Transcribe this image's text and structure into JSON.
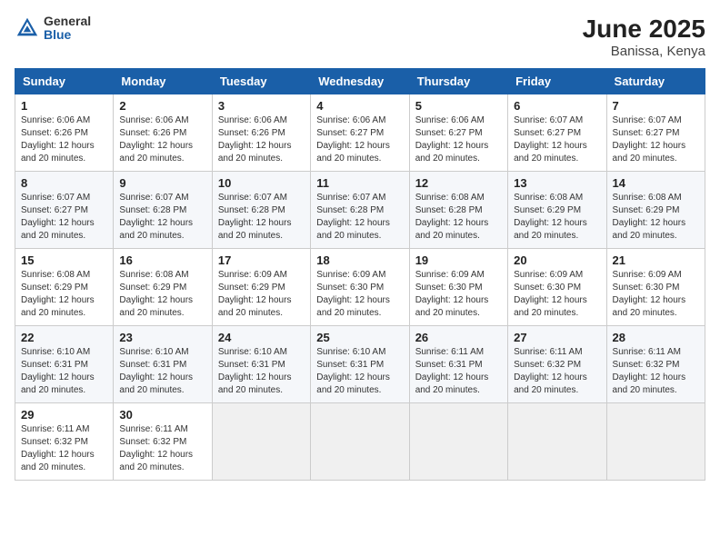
{
  "header": {
    "logo_general": "General",
    "logo_blue": "Blue",
    "month": "June 2025",
    "location": "Banissa, Kenya"
  },
  "weekdays": [
    "Sunday",
    "Monday",
    "Tuesday",
    "Wednesday",
    "Thursday",
    "Friday",
    "Saturday"
  ],
  "weeks": [
    [
      {
        "day": "1",
        "sunrise": "6:06 AM",
        "sunset": "6:26 PM",
        "daylight": "12 hours and 20 minutes."
      },
      {
        "day": "2",
        "sunrise": "6:06 AM",
        "sunset": "6:26 PM",
        "daylight": "12 hours and 20 minutes."
      },
      {
        "day": "3",
        "sunrise": "6:06 AM",
        "sunset": "6:26 PM",
        "daylight": "12 hours and 20 minutes."
      },
      {
        "day": "4",
        "sunrise": "6:06 AM",
        "sunset": "6:27 PM",
        "daylight": "12 hours and 20 minutes."
      },
      {
        "day": "5",
        "sunrise": "6:06 AM",
        "sunset": "6:27 PM",
        "daylight": "12 hours and 20 minutes."
      },
      {
        "day": "6",
        "sunrise": "6:07 AM",
        "sunset": "6:27 PM",
        "daylight": "12 hours and 20 minutes."
      },
      {
        "day": "7",
        "sunrise": "6:07 AM",
        "sunset": "6:27 PM",
        "daylight": "12 hours and 20 minutes."
      }
    ],
    [
      {
        "day": "8",
        "sunrise": "6:07 AM",
        "sunset": "6:27 PM",
        "daylight": "12 hours and 20 minutes."
      },
      {
        "day": "9",
        "sunrise": "6:07 AM",
        "sunset": "6:28 PM",
        "daylight": "12 hours and 20 minutes."
      },
      {
        "day": "10",
        "sunrise": "6:07 AM",
        "sunset": "6:28 PM",
        "daylight": "12 hours and 20 minutes."
      },
      {
        "day": "11",
        "sunrise": "6:07 AM",
        "sunset": "6:28 PM",
        "daylight": "12 hours and 20 minutes."
      },
      {
        "day": "12",
        "sunrise": "6:08 AM",
        "sunset": "6:28 PM",
        "daylight": "12 hours and 20 minutes."
      },
      {
        "day": "13",
        "sunrise": "6:08 AM",
        "sunset": "6:29 PM",
        "daylight": "12 hours and 20 minutes."
      },
      {
        "day": "14",
        "sunrise": "6:08 AM",
        "sunset": "6:29 PM",
        "daylight": "12 hours and 20 minutes."
      }
    ],
    [
      {
        "day": "15",
        "sunrise": "6:08 AM",
        "sunset": "6:29 PM",
        "daylight": "12 hours and 20 minutes."
      },
      {
        "day": "16",
        "sunrise": "6:08 AM",
        "sunset": "6:29 PM",
        "daylight": "12 hours and 20 minutes."
      },
      {
        "day": "17",
        "sunrise": "6:09 AM",
        "sunset": "6:29 PM",
        "daylight": "12 hours and 20 minutes."
      },
      {
        "day": "18",
        "sunrise": "6:09 AM",
        "sunset": "6:30 PM",
        "daylight": "12 hours and 20 minutes."
      },
      {
        "day": "19",
        "sunrise": "6:09 AM",
        "sunset": "6:30 PM",
        "daylight": "12 hours and 20 minutes."
      },
      {
        "day": "20",
        "sunrise": "6:09 AM",
        "sunset": "6:30 PM",
        "daylight": "12 hours and 20 minutes."
      },
      {
        "day": "21",
        "sunrise": "6:09 AM",
        "sunset": "6:30 PM",
        "daylight": "12 hours and 20 minutes."
      }
    ],
    [
      {
        "day": "22",
        "sunrise": "6:10 AM",
        "sunset": "6:31 PM",
        "daylight": "12 hours and 20 minutes."
      },
      {
        "day": "23",
        "sunrise": "6:10 AM",
        "sunset": "6:31 PM",
        "daylight": "12 hours and 20 minutes."
      },
      {
        "day": "24",
        "sunrise": "6:10 AM",
        "sunset": "6:31 PM",
        "daylight": "12 hours and 20 minutes."
      },
      {
        "day": "25",
        "sunrise": "6:10 AM",
        "sunset": "6:31 PM",
        "daylight": "12 hours and 20 minutes."
      },
      {
        "day": "26",
        "sunrise": "6:11 AM",
        "sunset": "6:31 PM",
        "daylight": "12 hours and 20 minutes."
      },
      {
        "day": "27",
        "sunrise": "6:11 AM",
        "sunset": "6:32 PM",
        "daylight": "12 hours and 20 minutes."
      },
      {
        "day": "28",
        "sunrise": "6:11 AM",
        "sunset": "6:32 PM",
        "daylight": "12 hours and 20 minutes."
      }
    ],
    [
      {
        "day": "29",
        "sunrise": "6:11 AM",
        "sunset": "6:32 PM",
        "daylight": "12 hours and 20 minutes."
      },
      {
        "day": "30",
        "sunrise": "6:11 AM",
        "sunset": "6:32 PM",
        "daylight": "12 hours and 20 minutes."
      },
      null,
      null,
      null,
      null,
      null
    ]
  ]
}
